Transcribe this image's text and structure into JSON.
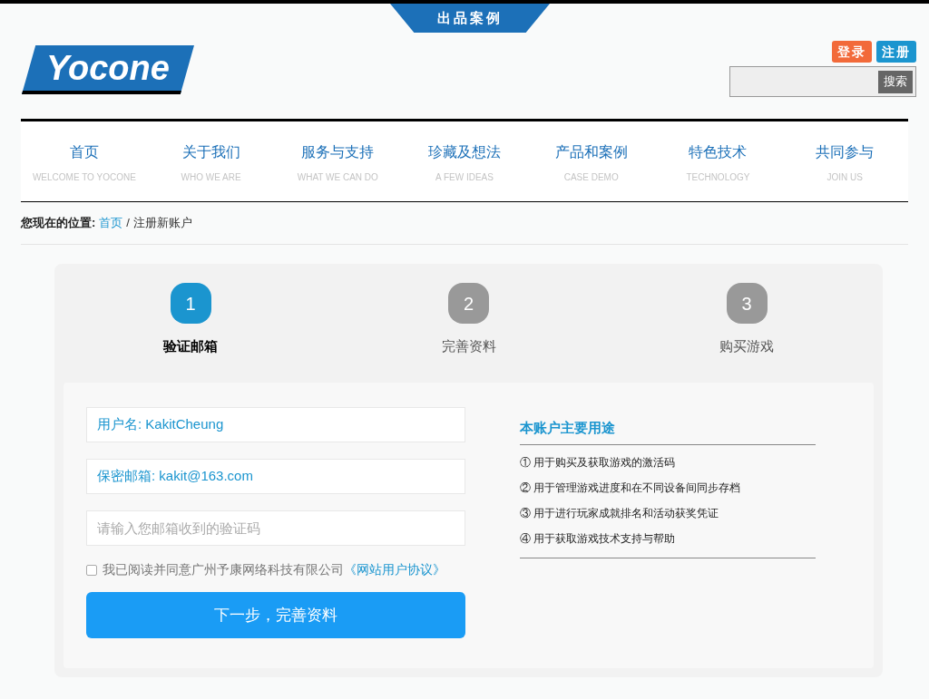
{
  "top_tab": "出品案例",
  "logo": "Yocone",
  "auth_buttons": [
    {
      "label": "登录",
      "kind": "login"
    },
    {
      "label": "注册",
      "kind": "register"
    }
  ],
  "search": {
    "button": "搜索"
  },
  "nav": [
    {
      "label": "首页",
      "sub": "WELCOME TO YOCONE"
    },
    {
      "label": "关于我们",
      "sub": "WHO WE ARE"
    },
    {
      "label": "服务与支持",
      "sub": "WHAT WE CAN DO"
    },
    {
      "label": "珍藏及想法",
      "sub": "A FEW IDEAS"
    },
    {
      "label": "产品和案例",
      "sub": "CASE DEMO"
    },
    {
      "label": "特色技术",
      "sub": "TECHNOLOGY"
    },
    {
      "label": "共同参与",
      "sub": "JOIN US"
    }
  ],
  "breadcrumb": {
    "label": "您现在的位置:",
    "link": "首页",
    "separator": "/",
    "current": "注册新账户"
  },
  "steps": [
    {
      "number": "1",
      "label": "验证邮箱",
      "selected": true
    },
    {
      "number": "2",
      "label": "完善资料",
      "selected": false
    },
    {
      "number": "3",
      "label": "购买游戏",
      "selected": false
    }
  ],
  "form": {
    "fields": [
      {
        "value": "用户名: KakitCheung"
      },
      {
        "value": "保密邮箱: kakit@163.com"
      },
      {
        "placeholder": "请输入您邮箱收到的验证码"
      }
    ],
    "agreement": {
      "checked": false,
      "text": "我已阅读并同意广州予康网络科技有限公司",
      "link": "《网站用户协议》"
    },
    "submit": "下一步，完善资料"
  },
  "uses": {
    "title": "本账户主要用途",
    "items": [
      "① 用于购买及获取游戏的激活码",
      "② 用于管理游戏进度和在不同设备间同步存档",
      "③ 用于进行玩家成就排名和活动获奖凭证",
      "④ 用于获取游戏技术支持与帮助"
    ]
  }
}
